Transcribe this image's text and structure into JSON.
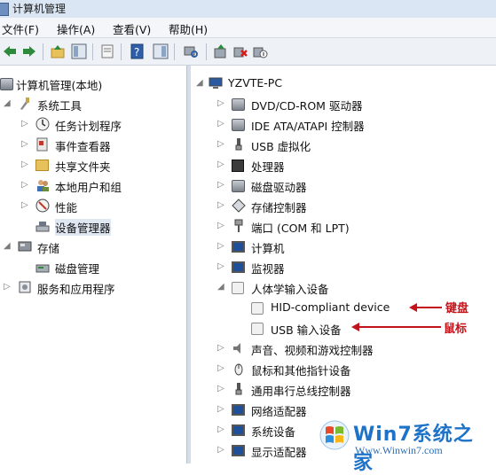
{
  "window": {
    "title": "计算机管理"
  },
  "menu": {
    "file": "文件(F)",
    "action": "操作(A)",
    "view": "查看(V)",
    "help": "帮助(H)"
  },
  "left_tree": {
    "root": "计算机管理(本地)",
    "system_tools": "系统工具",
    "task_scheduler": "任务计划程序",
    "event_viewer": "事件查看器",
    "shared_folders": "共享文件夹",
    "local_users": "本地用户和组",
    "performance": "性能",
    "device_manager": "设备管理器",
    "storage": "存储",
    "disk_management": "磁盘管理",
    "services_apps": "服务和应用程序"
  },
  "device_tree": {
    "root": "YZVTE-PC",
    "dvd": "DVD/CD-ROM 驱动器",
    "ide": "IDE ATA/ATAPI 控制器",
    "usb_virt": "USB 虚拟化",
    "processor": "处理器",
    "disk_drives": "磁盘驱动器",
    "storage_ctrl": "存储控制器",
    "ports": "端口 (COM 和 LPT)",
    "computer": "计算机",
    "monitors": "监视器",
    "hid": "人体学输入设备",
    "hid_device": "HID-compliant device",
    "usb_input": "USB 输入设备",
    "sound": "声音、视频和游戏控制器",
    "mice": "鼠标和其他指针设备",
    "usb_ctrl": "通用串行总线控制器",
    "network": "网络适配器",
    "system_devices": "系统设备",
    "display": "显示适配器"
  },
  "annotations": {
    "keyboard": "键盘",
    "mouse": "鼠标"
  },
  "watermark": {
    "brand": "Win7系统之家",
    "url": "Www.Winwin7.com"
  }
}
